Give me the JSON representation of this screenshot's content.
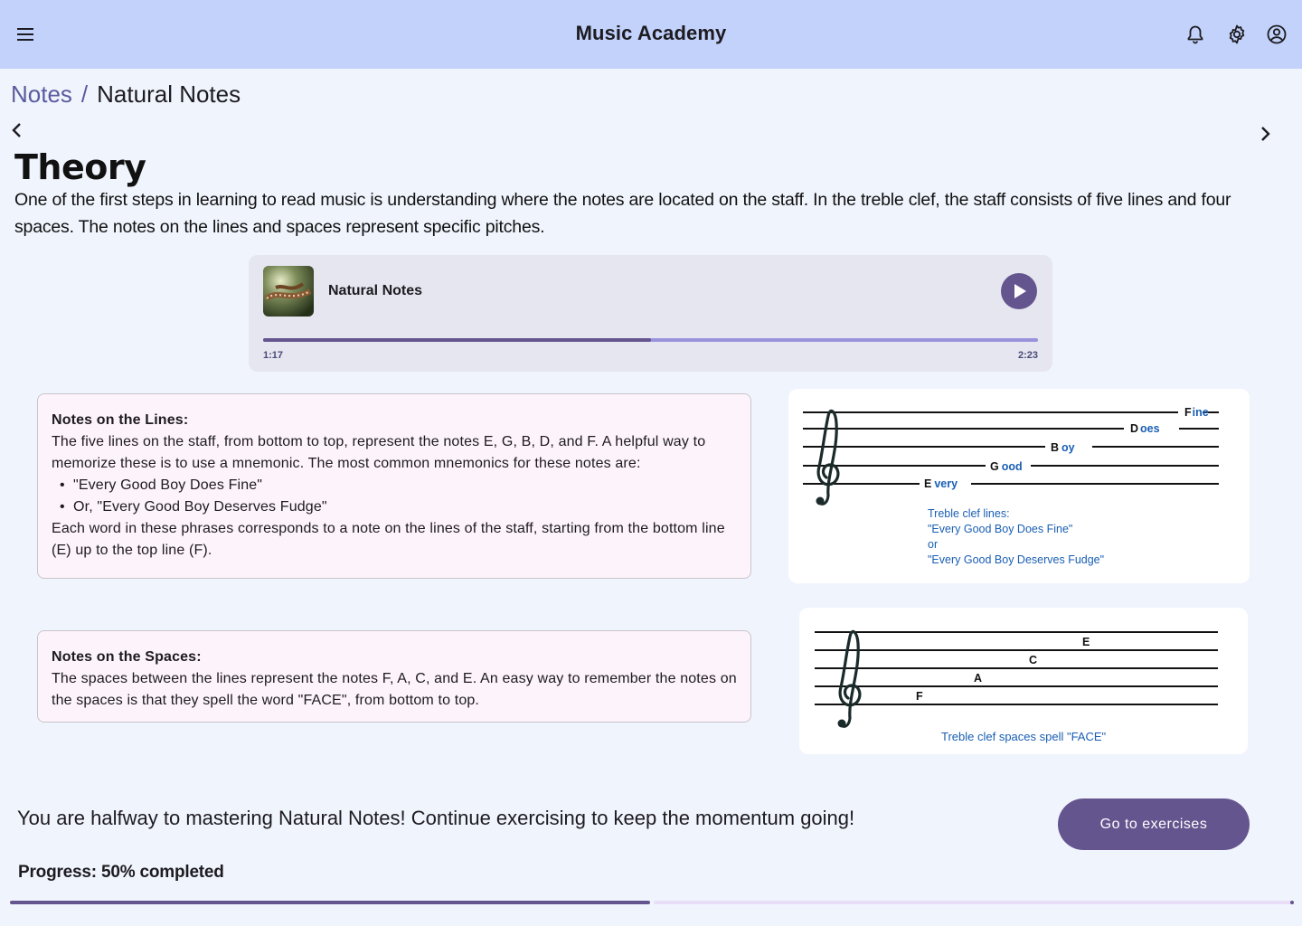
{
  "app": {
    "title": "Music Academy"
  },
  "breadcrumb": {
    "parent": "Notes",
    "separator": "/",
    "current": "Natural Notes"
  },
  "heading": "Theory",
  "intro": "One of the first steps in learning to read music is understanding where the notes are located on the staff. In the treble clef, the staff consists of five lines and four spaces. The notes on the lines and spaces represent specific pitches.",
  "player": {
    "track_title": "Natural Notes",
    "elapsed": "1:17",
    "duration": "2:23",
    "progress_fraction": 0.5
  },
  "lines_card": {
    "title": "Notes on the Lines:",
    "body": "The five lines on the staff, from bottom to top, represent the notes E, G, B, D, and F. A helpful way to memorize these is to use a mnemonic. The most common mnemonics for these notes are:",
    "bullets": [
      "\"Every Good Boy Does Fine\"",
      "Or, \"Every Good Boy Deserves Fudge\""
    ],
    "footer": "Each word in these phrases corresponds to a note on the lines of the staff, starting from the bottom line (E) up to the top line (F)."
  },
  "spaces_card": {
    "title": "Notes on the Spaces:",
    "body": "The spaces between the lines represent the notes F, A, C, and E. An easy way to remember the notes on the spaces is that they spell the word \"FACE\", from bottom to top."
  },
  "lines_figure": {
    "words": [
      {
        "letter": "E",
        "rest": "very"
      },
      {
        "letter": "G",
        "rest": "ood"
      },
      {
        "letter": "B",
        "rest": "oy"
      },
      {
        "letter": "D",
        "rest": "oes"
      },
      {
        "letter": "F",
        "rest": "ine"
      }
    ],
    "caption": [
      "Treble clef lines:",
      "\"Every Good Boy Does Fine\"",
      "or",
      "\"Every Good Boy Deserves Fudge\""
    ]
  },
  "spaces_figure": {
    "notes": [
      "F",
      "A",
      "C",
      "E"
    ],
    "caption": "Treble clef spaces spell \"FACE\""
  },
  "footer": {
    "message": "You are halfway to mastering Natural Notes! Continue exercising to keep the momentum going!",
    "cta_label": "Go to exercises",
    "progress_label": "Progress: 50% completed",
    "progress_fraction": 0.5
  },
  "colors": {
    "primary": "#65558f",
    "appbar": "#c2d2fb",
    "background": "#f0f4fd",
    "caption_blue": "#1a5fb4"
  },
  "icons": [
    "menu-icon",
    "bell-icon",
    "gear-icon",
    "account-icon",
    "chevron-left-icon",
    "chevron-right-icon",
    "play-icon"
  ]
}
